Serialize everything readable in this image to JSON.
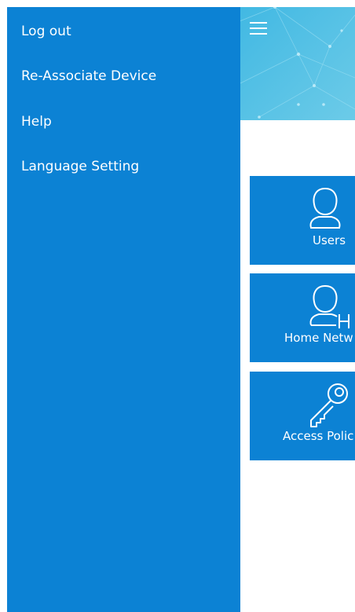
{
  "drawer": {
    "items": [
      {
        "label": "Log out"
      },
      {
        "label": "Re-Associate Device"
      },
      {
        "label": "Help"
      },
      {
        "label": "Language Setting"
      }
    ]
  },
  "header": {
    "menu_icon": "hamburger-menu-icon"
  },
  "tiles": [
    {
      "label": "Users",
      "icon": "user-icon"
    },
    {
      "label": "Home Netw",
      "icon": "home-network-user-icon"
    },
    {
      "label": "Access Polic",
      "icon": "key-icon"
    }
  ],
  "colors": {
    "accent": "#0c82d4",
    "banner": "#3cb6e2",
    "text_on_accent": "#ffffff"
  }
}
